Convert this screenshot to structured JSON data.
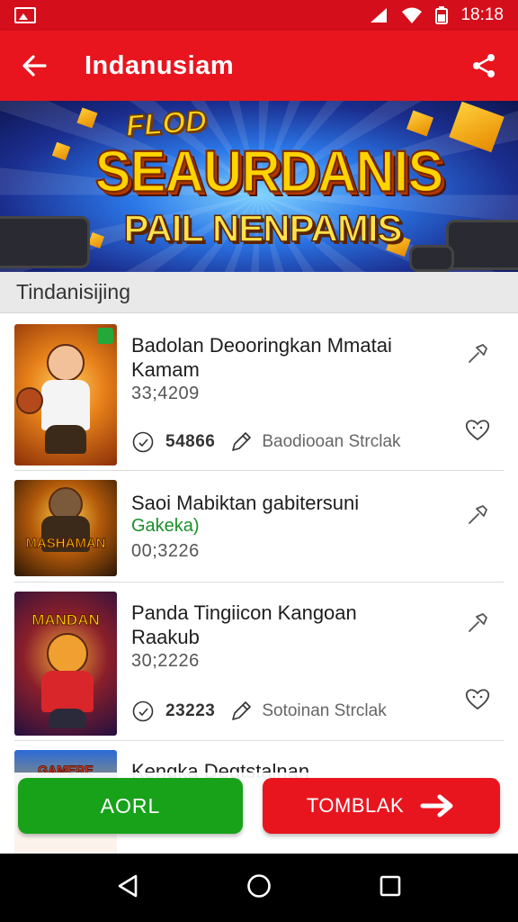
{
  "status_bar": {
    "time": "18:18"
  },
  "app_bar": {
    "title": "Indanusiam"
  },
  "banner": {
    "tagline": "FLOD",
    "title": "SEAURDANIS",
    "subtitle": "PAIL NENPAMIS"
  },
  "section": {
    "header": "Tindanisijing"
  },
  "items": [
    {
      "name": "Badolan Deooringkan Mmatai Kamam",
      "price": "33;4209",
      "count": "54866",
      "status": "Baodiooan Strclak"
    },
    {
      "name": "Saoi Mabiktan gabitersuni",
      "tag": "Gakeka)",
      "price": "00;3226"
    },
    {
      "name": "Panda Tingiicon Kangoan Raakub",
      "price": "30;2226",
      "count": "23223",
      "status": "Sotoinan Strclak"
    },
    {
      "name": "Kengka Degtstalnan"
    }
  ],
  "thumbs": {
    "item2_text": "MASHAMAN",
    "item3_text": "MANDAN",
    "item4_text": "GAMERE"
  },
  "buttons": {
    "left": "AORL",
    "right": "TOMBLAK"
  },
  "colors": {
    "primary_red": "#e8151f",
    "green": "#17a21a"
  }
}
